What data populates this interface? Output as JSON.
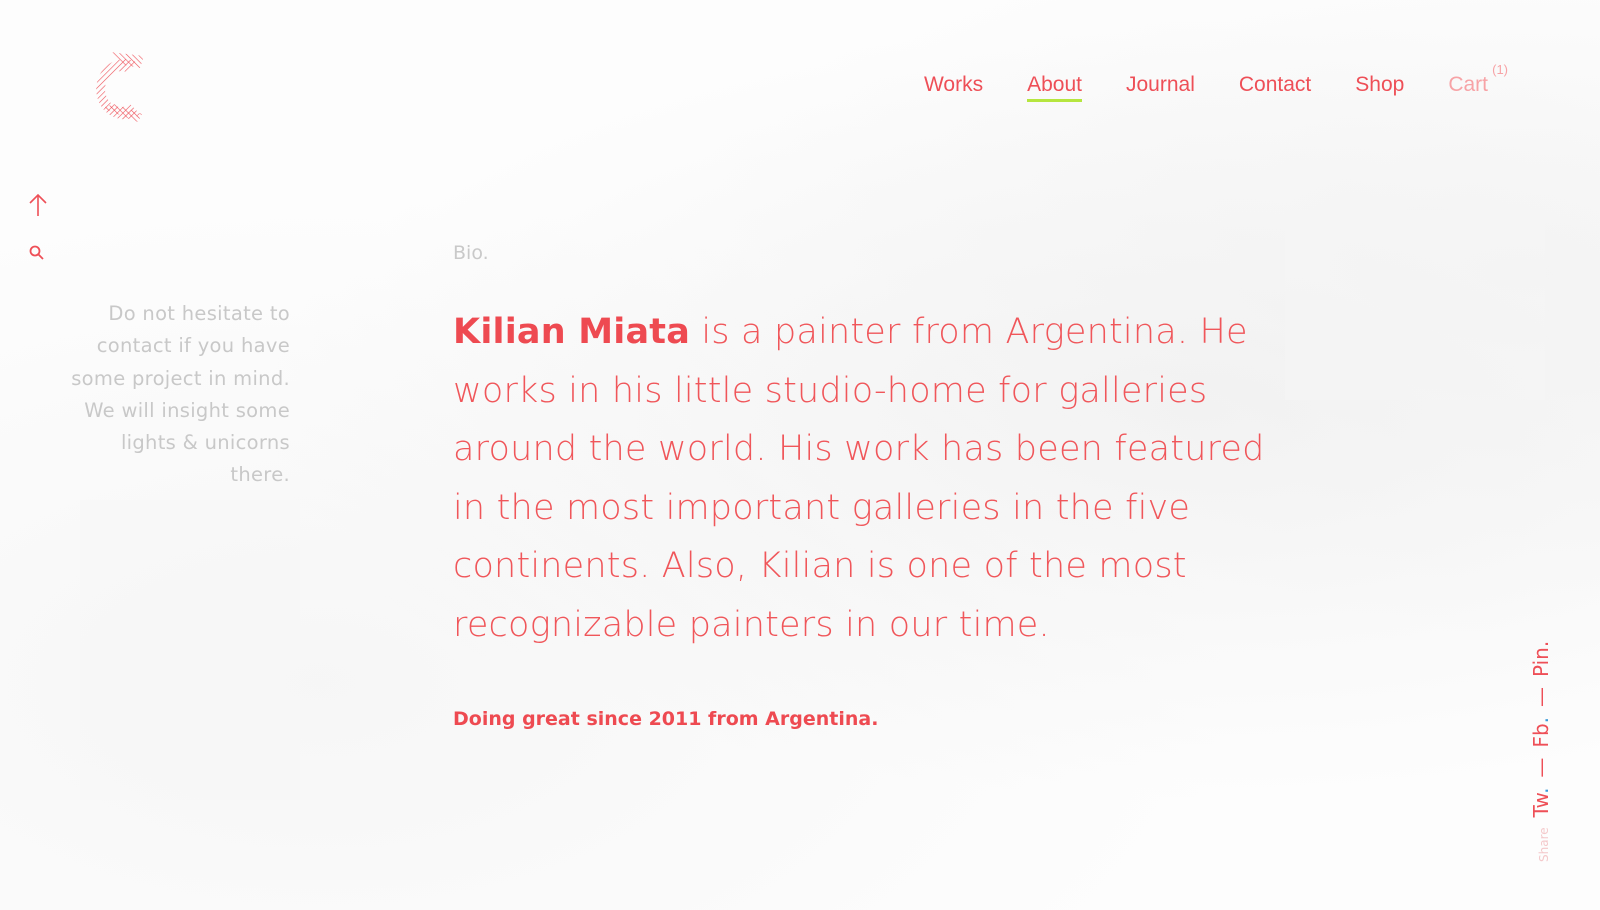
{
  "nav": {
    "items": [
      {
        "label": "Works",
        "active": false
      },
      {
        "label": "About",
        "active": true
      },
      {
        "label": "Journal",
        "active": false
      },
      {
        "label": "Contact",
        "active": false
      },
      {
        "label": "Shop",
        "active": false
      }
    ],
    "cart_label": "Cart",
    "cart_count": "(1)"
  },
  "side": {
    "note": "Do not hesitate to contact if you have some project in mind. We will insight some lights & unicorns there."
  },
  "main": {
    "bio_label": "Bio.",
    "bio_name": "Kilian Miata",
    "bio_text": " is a painter from Argentina. He works in his little studio-home for galleries around the world. His work has been featured in the most important galleries in the five continents. Also, Kilian is one of the most recognizable painters in our time.",
    "since": "Doing great since 2011 from Argentina."
  },
  "share": {
    "label": "Share",
    "links": [
      {
        "label": "Tw",
        "dot": "."
      },
      {
        "label": "Fb",
        "dot": "."
      },
      {
        "label": "Pin",
        "dot": "."
      }
    ],
    "separator": "—"
  },
  "icons": {
    "logo": "c-logo-icon",
    "up": "arrow-up-icon",
    "search": "search-icon"
  },
  "colors": {
    "accent": "#ee4f57",
    "active_underline": "#b6e63f",
    "muted_text": "#c8c8c8",
    "share_dot_blue": "#3a9ad9"
  }
}
